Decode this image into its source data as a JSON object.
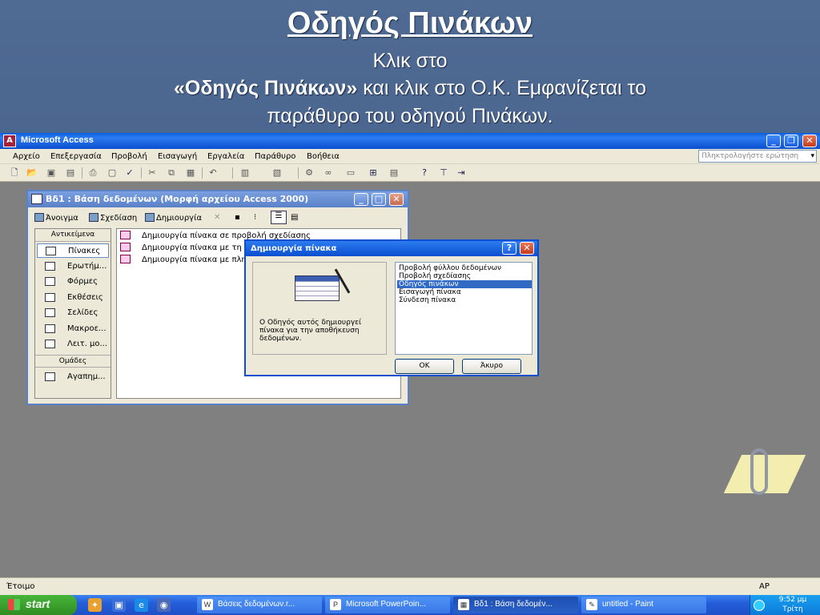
{
  "slide": {
    "title": "Οδηγός Πινάκων",
    "line1": "Κλικ στο",
    "line2_bold": "«Οδηγός Πινάκων»",
    "line2_rest": " και κλικ στο Ο.Κ. Εμφανίζεται το",
    "line3": "παράθυρο του οδηγού Πινάκων."
  },
  "app": {
    "title": "Microsoft Access",
    "menu": [
      "Αρχείο",
      "Επεξεργασία",
      "Προβολή",
      "Εισαγωγή",
      "Εργαλεία",
      "Παράθυρο",
      "Βοήθεια"
    ],
    "help_placeholder": "Πληκτρολογήστε ερώτηση",
    "status_left": "Έτοιμο",
    "status_right": "ΑΡ"
  },
  "db": {
    "title": "Βδ1 : Βάση δεδομένων (Μορφή αρχείου Access 2000)",
    "toolbar": {
      "open": "Άνοιγμα",
      "design": "Σχεδίαση",
      "create": "Δημιουργία"
    },
    "objects_header": "Αντικείμενα",
    "objects": [
      "Πίνακες",
      "Ερωτήμ...",
      "Φόρμες",
      "Εκθέσεις",
      "Σελίδες",
      "Μακροε...",
      "Λειτ. μο..."
    ],
    "groups_header": "Ομάδες",
    "groups": [
      "Αγαπημ..."
    ],
    "list": [
      "Δημιουργία πίνακα σε προβολή σχεδίασης",
      "Δημιουργία πίνακα με τη χρήση οδηγού",
      "Δημιουργία πίνακα με πληκτρολόγηση δεδομένων"
    ]
  },
  "dialog": {
    "title": "Δημιουργία πίνακα",
    "description": "Ο Οδηγός αυτός δημιουργεί πίνακα για την αποθήκευση δεδομένων.",
    "options": [
      "Προβολή φύλλου δεδομένων",
      "Προβολή σχεδίασης",
      "Οδηγός πινάκων",
      "Εισαγωγή πίνακα",
      "Σύνδεση πίνακα"
    ],
    "selected_option": "Οδηγός πινάκων",
    "ok": "ΟΚ",
    "cancel": "Άκυρο"
  },
  "taskbar": {
    "start": "start",
    "tasks": [
      "Βάσεις δεδομένων.r...",
      "Microsoft PowerPoin...",
      "Βδ1 : Βάση δεδομέν...",
      "untitled - Paint"
    ],
    "time": "9:52 μμ",
    "day": "Τρίτη"
  },
  "icons": [
    "access-icon",
    "new-icon",
    "open-icon",
    "save-icon",
    "print-icon",
    "spell-icon",
    "cut-icon",
    "copy-icon",
    "paste-icon",
    "undo-icon",
    "wizard-icon",
    "clippy-icon",
    "windows-flag-icon",
    "clock-icon"
  ]
}
